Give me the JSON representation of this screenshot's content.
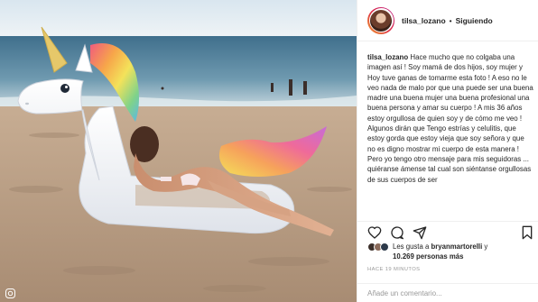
{
  "post": {
    "username": "tilsa_lozano",
    "separator": "•",
    "follow_label": "Siguiendo",
    "caption_user": "tilsa_lozano",
    "caption_text": "Hace mucho que no colgaba una imagen así ! Soy mamá de dos hijos, soy mujer y Hoy tuve ganas de tomarme esta foto ! A eso no le veo nada de malo por que una puede ser una buena madre una buena mujer una buena profesional una buena persona y amar su cuerpo ! A mis 36 años estoy orgullosa de quien soy y de cómo me veo ! Algunos dirán que Tengo estrías y celulitis, que estoy gorda que estoy vieja que soy señora y que no es digno mostrar mi cuerpo de esta manera ! Pero yo tengo otro mensaje para mis seguidoras ... quiéranse ámense tal cual son siéntanse orgullosas de sus cuerpos de ser",
    "likes_prefix": "Les gusta a ",
    "likes_user": "bryanmartorelli",
    "likes_middle": " y",
    "likes_count": "10.269 personas más",
    "timestamp": "HACE 19 MINUTOS",
    "comment_placeholder": "Añade un comentario..."
  },
  "icons": {
    "like": "heart-icon",
    "comment": "comment-icon",
    "share": "share-icon",
    "save": "bookmark-icon",
    "corner": "instagram-glyph-icon"
  },
  "colors": {
    "follow_text": "#262626",
    "meta_text": "#999999",
    "divider": "#efefef"
  }
}
